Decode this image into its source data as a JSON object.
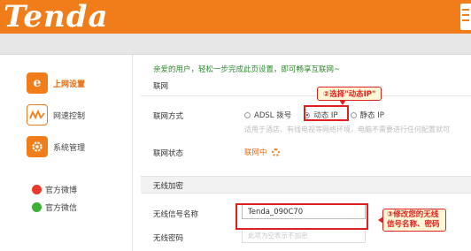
{
  "header": {
    "logo": "Tenda"
  },
  "sidebar": {
    "items": [
      {
        "label": "上网设置",
        "icon": "internet-e-icon",
        "active": true
      },
      {
        "label": "网速控制",
        "icon": "speed-wave-icon",
        "active": false
      },
      {
        "label": "系统管理",
        "icon": "system-gear-icon",
        "active": false
      }
    ],
    "social": [
      {
        "label": "官方微博",
        "icon": "weibo-icon"
      },
      {
        "label": "官方微信",
        "icon": "wechat-icon"
      }
    ]
  },
  "main": {
    "welcome": "亲爱的用户，轻松一步完成此页设置，即可畅享互联网~",
    "section_internet": "联网",
    "conn_label": "联网方式",
    "radios": [
      {
        "label": "ADSL 拨号",
        "selected": false
      },
      {
        "label": "动态 IP",
        "selected": true
      },
      {
        "label": "静态 IP",
        "selected": false
      }
    ],
    "hint": "适用于酒店、有线电视等网络环境，电脑不需要进行任何配置就可",
    "status_label": "联网状态",
    "status_value": "联网中",
    "section_wireless": "无线加密",
    "ssid_label": "无线信号名称",
    "ssid_value": "Tenda_090C70",
    "pwd_label": "无线密码",
    "pwd_placeholder": "此项为空表示不加密"
  },
  "annotations": {
    "step1": "②选择\"动态IP\"",
    "step2": "③修改您的无线信号名称、密码"
  },
  "colors": {
    "brand": "#f07d1a",
    "annotation": "#e02020",
    "welcome": "#2a8a2a"
  }
}
